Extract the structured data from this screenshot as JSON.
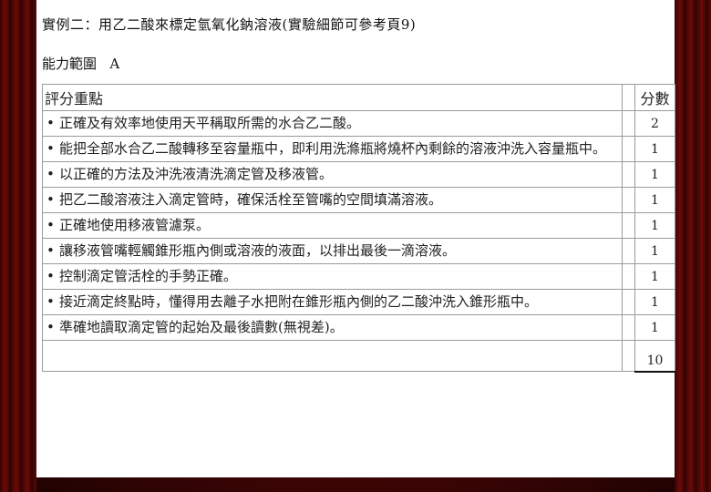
{
  "document": {
    "title": "實例二：用乙二酸來標定氫氧化鈉溶液(實驗細節可參考頁9)",
    "ability_label": "能力範圍",
    "ability_value": "A",
    "table": {
      "header_criteria": "評分重點",
      "header_score": "分數",
      "bullet": "•",
      "rows": [
        {
          "text": "正確及有效率地使用天平稱取所需的水合乙二酸。",
          "score": "2"
        },
        {
          "text": "能把全部水合乙二酸轉移至容量瓶中，即利用洗滌瓶將燒杯內剩餘的溶液沖洗入容量瓶中。",
          "score": "1"
        },
        {
          "text": "以正確的方法及沖洗液清洗滴定管及移液管。",
          "score": "1"
        },
        {
          "text": "把乙二酸溶液注入滴定管時，確保活栓至管嘴的空間填滿溶液。",
          "score": "1"
        },
        {
          "text": "正確地使用移液管濾泵。",
          "score": "1"
        },
        {
          "text": "讓移液管嘴輕觸錐形瓶內側或溶液的液面，以排出最後一滴溶液。",
          "score": "1"
        },
        {
          "text": "控制滴定管活栓的手勢正確。",
          "score": "1"
        },
        {
          "text": "接近滴定終點時，懂得用去離子水把附在錐形瓶內側的乙二酸沖洗入錐形瓶中。",
          "score": "1"
        },
        {
          "text": "準確地讀取滴定管的起始及最後讀數(無視差)。",
          "score": "1"
        }
      ],
      "total": "10"
    }
  }
}
